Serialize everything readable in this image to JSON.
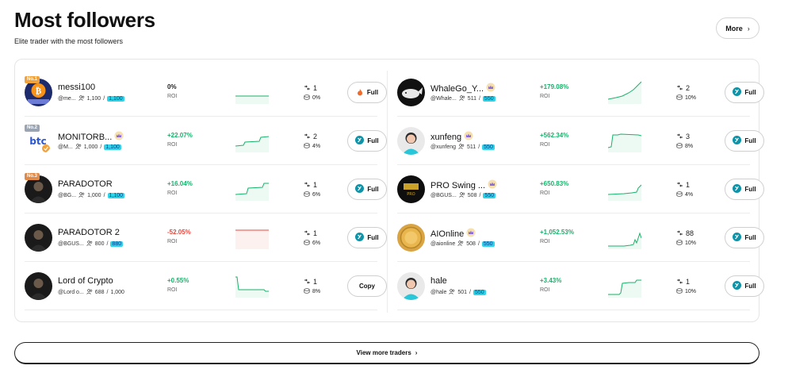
{
  "header": {
    "title": "Most followers",
    "subtitle": "Elite trader with the most followers",
    "more_label": "More"
  },
  "colors": {
    "positive": "#18b26b",
    "negative": "#e5483e",
    "accent": "#2fd4e8",
    "rank1": "#f2a23a",
    "rank2": "#9aa4b2",
    "rank3": "#e08a4a"
  },
  "traders_left": [
    {
      "name": "messi100",
      "rank": "No.1",
      "handle": "@me...",
      "followers": "1,100",
      "cap": "1,100",
      "cap_highlight": true,
      "roi": "0%",
      "roi_label": "ROI",
      "roi_sign": "zero",
      "copies": "1",
      "win": "0%",
      "button": "Full",
      "button_icon": "fire-icon",
      "avatar_icon": "bitcoin-avatar"
    },
    {
      "name": "MONITORB...",
      "rank": "No.2",
      "handle": "@M...",
      "followers": "1,000",
      "cap": "1,100",
      "cap_highlight": true,
      "roi": "+22.07%",
      "roi_label": "ROI",
      "roi_sign": "pos",
      "copies": "2",
      "win": "4%",
      "button": "Full",
      "button_icon": "bitget-icon",
      "avatar_icon": "btc-logo-avatar"
    },
    {
      "name": "PARADOTOR",
      "rank": "No.3",
      "handle": "@BG...",
      "followers": "1,000",
      "cap": "1,100",
      "cap_highlight": true,
      "roi": "+16.04%",
      "roi_label": "ROI",
      "roi_sign": "pos",
      "copies": "1",
      "win": "6%",
      "button": "Full",
      "button_icon": "bitget-icon",
      "avatar_icon": "person-avatar"
    },
    {
      "name": "PARADOTOR 2",
      "rank": "",
      "handle": "@BGUS...",
      "followers": "800",
      "cap": "880",
      "cap_highlight": true,
      "roi": "-52.05%",
      "roi_label": "ROI",
      "roi_sign": "neg",
      "copies": "1",
      "win": "6%",
      "button": "Full",
      "button_icon": "bitget-icon",
      "avatar_icon": "person-avatar"
    },
    {
      "name": "Lord of Crypto",
      "rank": "",
      "handle": "@Lord o...",
      "followers": "688",
      "cap": "1,000",
      "cap_highlight": false,
      "roi": "+0.55%",
      "roi_label": "ROI",
      "roi_sign": "pos",
      "copies": "1",
      "win": "8%",
      "button": "Copy",
      "button_icon": "",
      "avatar_icon": "person-avatar"
    }
  ],
  "traders_right": [
    {
      "name": "WhaleGo_Y...",
      "handle": "@Whale...",
      "followers": "511",
      "cap": "550",
      "roi": "+179.08%",
      "roi_label": "ROI",
      "roi_sign": "pos",
      "copies": "2",
      "win": "10%",
      "button": "Full",
      "button_icon": "bitget-icon",
      "avatar_icon": "whale-avatar"
    },
    {
      "name": "xunfeng",
      "handle": "@xunfeng",
      "followers": "511",
      "cap": "550",
      "roi": "+562.34%",
      "roi_label": "ROI",
      "roi_sign": "pos",
      "copies": "3",
      "win": "8%",
      "button": "Full",
      "button_icon": "bitget-icon",
      "avatar_icon": "default-avatar"
    },
    {
      "name": "PRO Swing ...",
      "handle": "@BGUS...",
      "followers": "508",
      "cap": "550",
      "roi": "+650.83%",
      "roi_label": "ROI",
      "roi_sign": "pos",
      "copies": "1",
      "win": "4%",
      "button": "Full",
      "button_icon": "bitget-icon",
      "avatar_icon": "pro-swing-avatar"
    },
    {
      "name": "AIOnline",
      "handle": "@aionline",
      "followers": "508",
      "cap": "550",
      "roi": "+1,052.53%",
      "roi_label": "ROI",
      "roi_sign": "pos",
      "copies": "88",
      "win": "10%",
      "button": "Full",
      "button_icon": "bitget-icon",
      "avatar_icon": "gold-coin-avatar"
    },
    {
      "name": "hale",
      "handle": "@hale",
      "followers": "501",
      "cap": "550",
      "roi": "+3.43%",
      "roi_label": "ROI",
      "roi_sign": "pos",
      "copies": "1",
      "win": "10%",
      "button": "Full",
      "button_icon": "bitget-icon",
      "avatar_icon": "default-avatar"
    }
  ],
  "view_more_label": "View more traders"
}
